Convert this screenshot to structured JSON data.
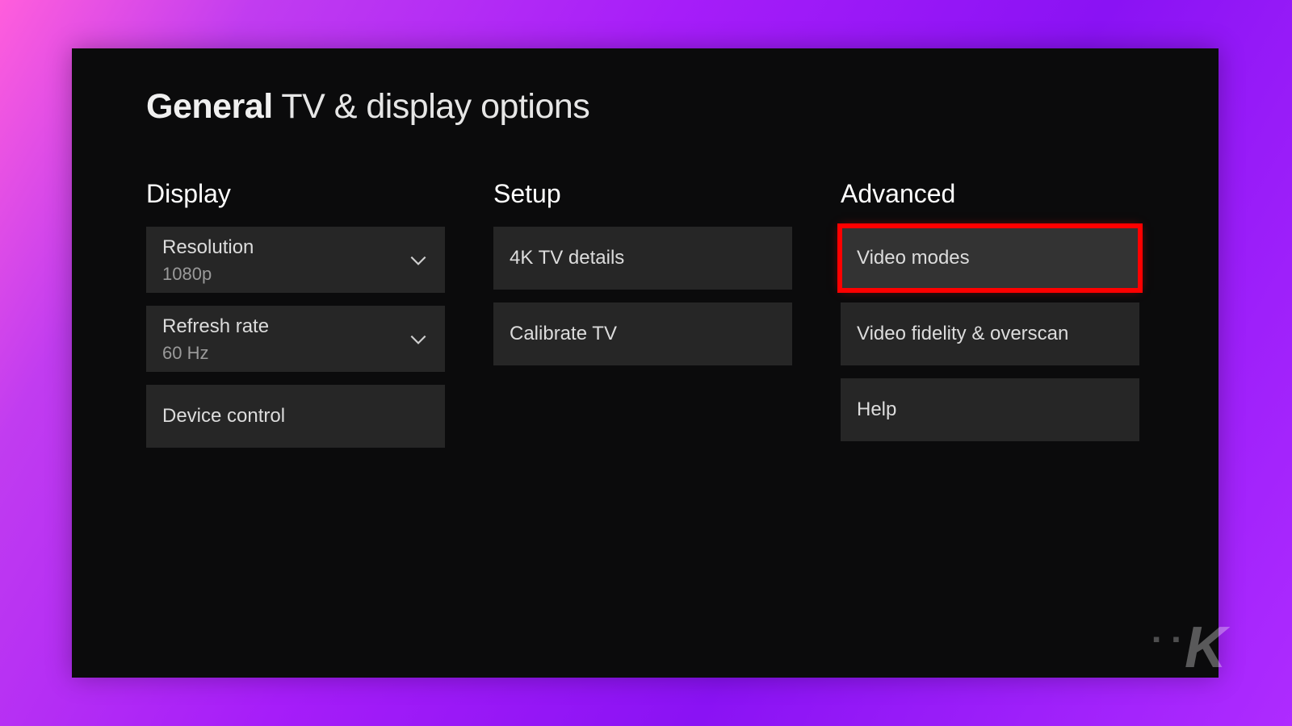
{
  "header": {
    "breadcrumb_bold": "General",
    "breadcrumb_light": "TV & display options"
  },
  "columns": {
    "display": {
      "title": "Display",
      "resolution": {
        "label": "Resolution",
        "value": "1080p"
      },
      "refresh": {
        "label": "Refresh rate",
        "value": "60 Hz"
      },
      "device": {
        "label": "Device control"
      }
    },
    "setup": {
      "title": "Setup",
      "details": {
        "label": "4K TV details"
      },
      "calibrate": {
        "label": "Calibrate TV"
      }
    },
    "advanced": {
      "title": "Advanced",
      "modes": {
        "label": "Video modes"
      },
      "fidelity": {
        "label": "Video fidelity & overscan"
      },
      "help": {
        "label": "Help"
      }
    }
  },
  "watermark": "K",
  "colors": {
    "highlight_outline": "#ff0000",
    "tile_bg": "#262626",
    "window_bg": "#0b0b0c"
  }
}
